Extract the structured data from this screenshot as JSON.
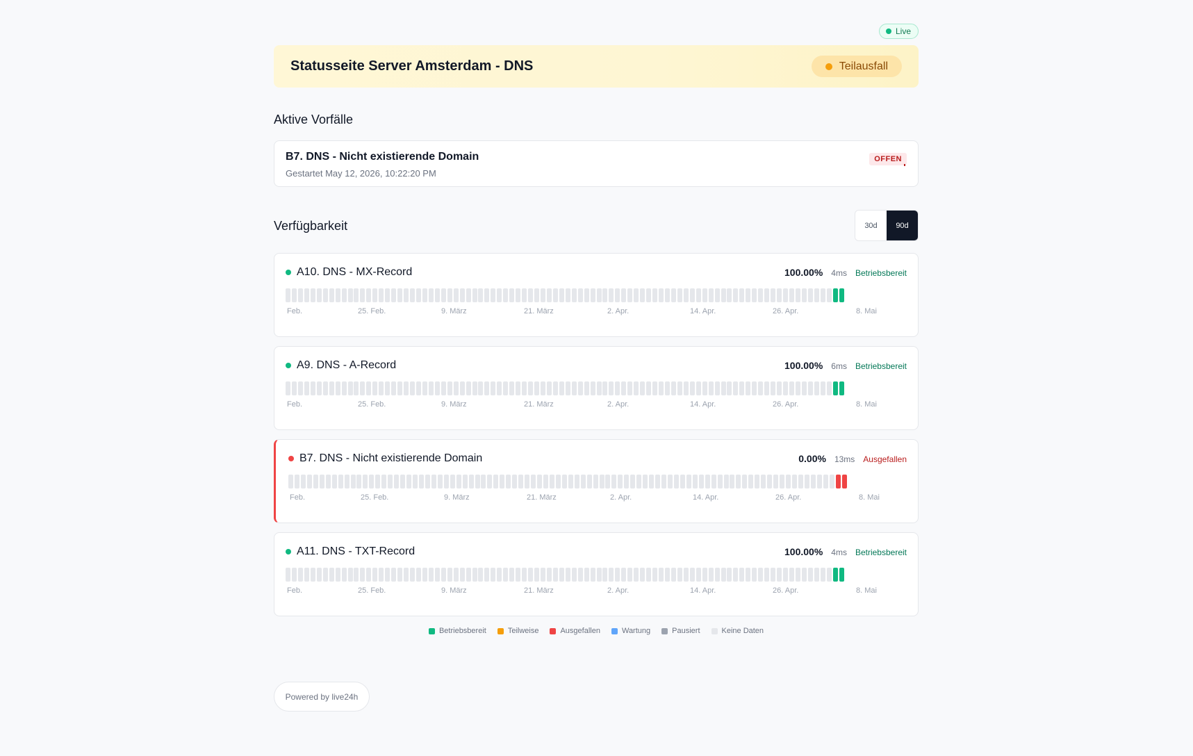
{
  "live_badge": "Live",
  "header": {
    "title": "Statusseite Server Amsterdam - DNS",
    "status": "Teilausfall"
  },
  "incidents": {
    "heading": "Aktive Vorfälle",
    "items": [
      {
        "title": "B7. DNS - Nicht existierende Domain",
        "started": "Gestartet May 12, 2026, 10:22:20 PM",
        "badge": "OFFEN"
      }
    ]
  },
  "availability": {
    "heading": "Verfügbarkeit",
    "ranges": [
      "30d",
      "90d"
    ],
    "selected_range": "90d",
    "axis_labels": [
      "Feb.",
      "25. Feb.",
      "9. März",
      "21. März",
      "2. Apr.",
      "14. Apr.",
      "26. Apr.",
      "8. Mai"
    ],
    "monitors": [
      {
        "name": "A10. DNS - MX-Record",
        "uptime": "100.00%",
        "latency": "4ms",
        "state": "Betriebsbereit",
        "status": "up",
        "bars_no_data": 88,
        "bars_status": 2
      },
      {
        "name": "A9. DNS - A-Record",
        "uptime": "100.00%",
        "latency": "6ms",
        "state": "Betriebsbereit",
        "status": "up",
        "bars_no_data": 88,
        "bars_status": 2
      },
      {
        "name": "B7. DNS - Nicht existierende Domain",
        "uptime": "0.00%",
        "latency": "13ms",
        "state": "Ausgefallen",
        "status": "down",
        "bars_no_data": 88,
        "bars_status": 2
      },
      {
        "name": "A11. DNS - TXT-Record",
        "uptime": "100.00%",
        "latency": "4ms",
        "state": "Betriebsbereit",
        "status": "up",
        "bars_no_data": 88,
        "bars_status": 2
      }
    ]
  },
  "legend": [
    {
      "label": "Betriebsbereit",
      "color": "#10b981"
    },
    {
      "label": "Teilweise",
      "color": "#f59e0b"
    },
    {
      "label": "Ausgefallen",
      "color": "#ef4444"
    },
    {
      "label": "Wartung",
      "color": "#60a5fa"
    },
    {
      "label": "Pausiert",
      "color": "#9ca3af"
    },
    {
      "label": "Keine Daten",
      "color": "#e5e7eb"
    }
  ],
  "colors": {
    "up": "#10b981",
    "down": "#ef4444",
    "up_text": "#047857",
    "down_text": "#b91c1c",
    "no_data": "#e5e7eb"
  },
  "footer": "Powered by live24h"
}
